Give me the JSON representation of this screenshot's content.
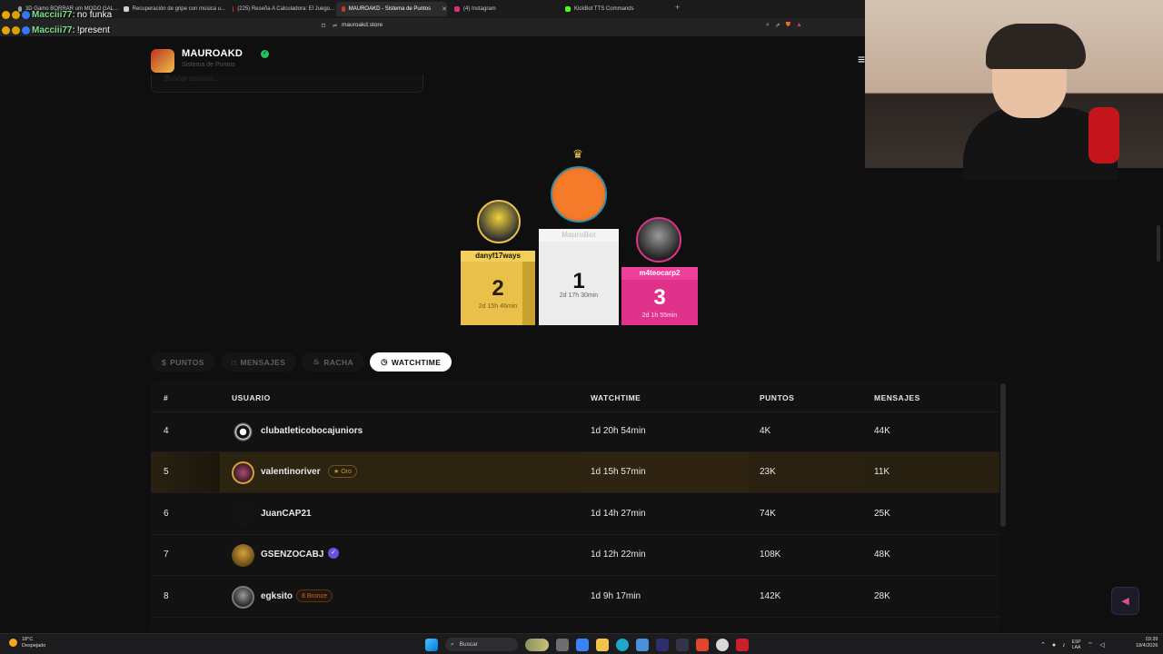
{
  "browser": {
    "tabs": [
      {
        "label": "3D Gamo BORRAR um MODO GAL..."
      },
      {
        "label": "Recuperación de gripe con música u..."
      },
      {
        "label": "(225) Reseña A Calculadora: El Juego..."
      },
      {
        "label": "MAUROAKD - Sistema de Puntos"
      },
      {
        "label": "(4) Instagram"
      },
      {
        "label": "KickBot TTS Commands"
      }
    ],
    "url": "mauroakd.store"
  },
  "chat": {
    "messages": [
      {
        "user": "Macciii77:",
        "text": "no funka"
      },
      {
        "user": "Macciii77:",
        "text": "!present"
      }
    ]
  },
  "site": {
    "brand": "MAUROAKD",
    "subtitle": "Sistema de Puntos",
    "search_placeholder": "Buscar usuario..."
  },
  "podium": [
    {
      "rank": "2",
      "name": "danyf17ways",
      "time": "2d 15h 46min",
      "color": "#e8c04a"
    },
    {
      "rank": "1",
      "name": "MauroBot",
      "time": "2d 17h 30min",
      "color": "#e6e6e6"
    },
    {
      "rank": "3",
      "name": "m4teocarp2",
      "time": "2d 1h 55min",
      "color": "#e0328b"
    }
  ],
  "filters": [
    {
      "icon": "$",
      "label": "PUNTOS"
    },
    {
      "icon": "□",
      "label": "MENSAJES"
    },
    {
      "icon": "♨",
      "label": "RACHA"
    },
    {
      "icon": "◷",
      "label": "WATCHTIME"
    }
  ],
  "table": {
    "headers": [
      "#",
      "USUARIO",
      "WATCHTIME",
      "PUNTOS",
      "MENSAJES"
    ],
    "rows": [
      {
        "rank": "4",
        "user": "clubatleticobocajuniors",
        "watchtime": "1d 20h 54min",
        "puntos": "4K",
        "mensajes": "44K",
        "tag": ""
      },
      {
        "rank": "5",
        "user": "valentinoriver",
        "watchtime": "1d 15h 57min",
        "puntos": "23K",
        "mensajes": "11K",
        "tag": "★ Oro"
      },
      {
        "rank": "6",
        "user": "JuanCAP21",
        "watchtime": "1d 14h 27min",
        "puntos": "74K",
        "mensajes": "25K",
        "tag": ""
      },
      {
        "rank": "7",
        "user": "GSENZOCABJ",
        "watchtime": "1d 12h 22min",
        "puntos": "108K",
        "mensajes": "48K",
        "tag": ""
      },
      {
        "rank": "8",
        "user": "egksito",
        "watchtime": "1d 9h 17min",
        "puntos": "142K",
        "mensajes": "28K",
        "tag": "8 Bronce"
      }
    ]
  },
  "taskbar": {
    "weather_temp": "18°C",
    "weather_desc": "Despejado",
    "search_label": "Buscar",
    "lang": "ESP",
    "lang2": "LAA",
    "time": "03:39",
    "date": "18/4/2026"
  }
}
